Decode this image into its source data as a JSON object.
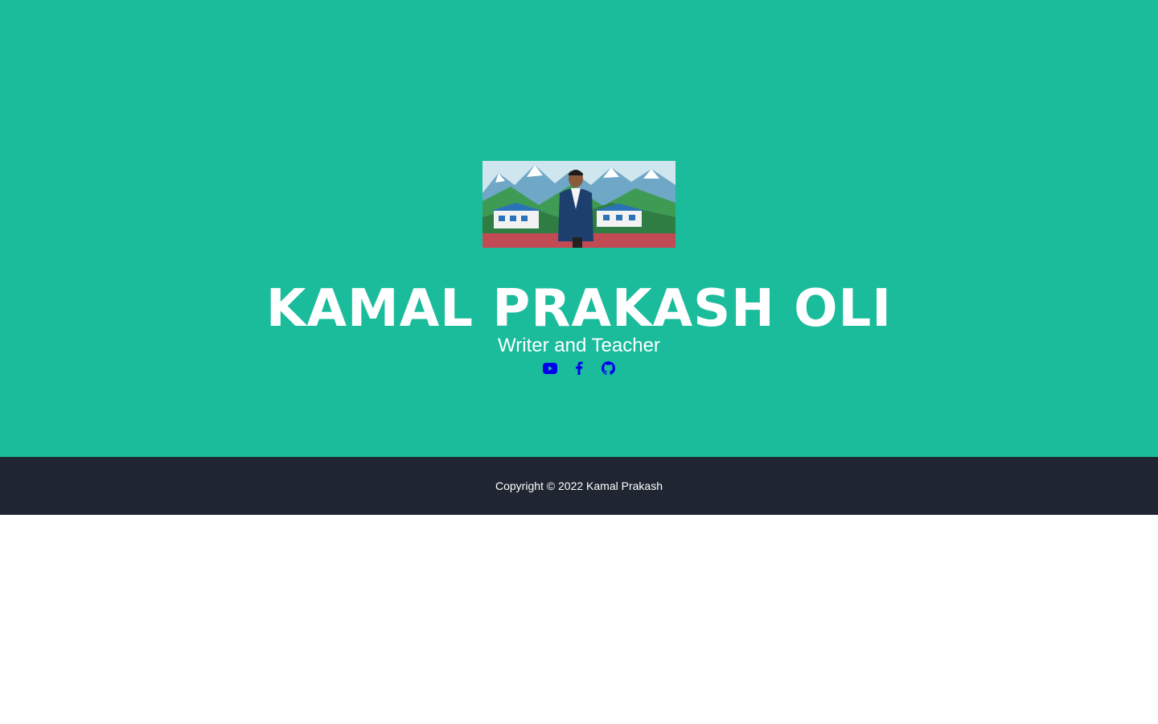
{
  "header": {
    "name": "KAMAL PRAKASH OLI",
    "tagline": "Writer and Teacher"
  },
  "social": [
    {
      "icon": "youtube-icon"
    },
    {
      "icon": "facebook-icon"
    },
    {
      "icon": "github-icon"
    }
  ],
  "footer": {
    "copyright": "Copyright © 2022 Kamal Prakash"
  },
  "colors": {
    "hero_background": "#1abc9c",
    "footer_background": "#1f2631",
    "link": "#0000ee"
  }
}
